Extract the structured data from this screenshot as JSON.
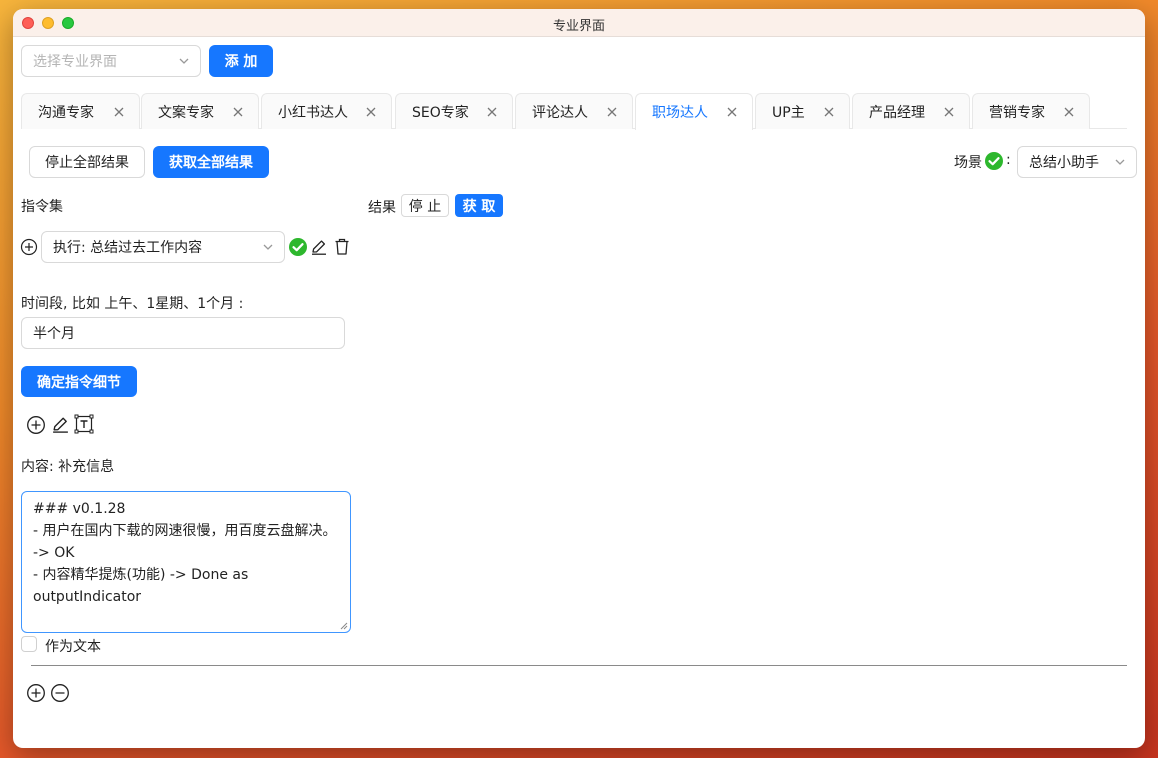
{
  "window": {
    "title": "专业界面"
  },
  "toolbar": {
    "select_placeholder": "选择专业界面",
    "add_label": "添 加"
  },
  "tabs": [
    {
      "label": "沟通专家",
      "active": false
    },
    {
      "label": "文案专家",
      "active": false
    },
    {
      "label": "小红书达人",
      "active": false
    },
    {
      "label": "SEO专家",
      "active": false
    },
    {
      "label": "评论达人",
      "active": false
    },
    {
      "label": "职场达人",
      "active": true
    },
    {
      "label": "UP主",
      "active": false
    },
    {
      "label": "产品经理",
      "active": false
    },
    {
      "label": "营销专家",
      "active": false
    }
  ],
  "actions": {
    "stop_all_label": "停止全部结果",
    "fetch_all_label": "获取全部结果",
    "scene_label": "场景",
    "scene_colon": ":",
    "scene_value": "总结小助手"
  },
  "instructions": {
    "section_label": "指令集",
    "command_value": "执行: 总结过去工作内容",
    "param_label": "时间段, 比如 上午、1星期、1个月 :",
    "param_value": "半个月",
    "confirm_label": "确定指令细节",
    "content_label": "内容: 补充信息",
    "content_lines": [
      "### v0.1.28",
      "",
      "- 用户在国内下载的网速很慢，用百度云盘解决。",
      "-> OK",
      "- 内容精华提炼(功能) -> Done as",
      "outputIndicator"
    ],
    "as_text_label": "作为文本"
  },
  "result": {
    "label": "结果",
    "stop_label": "停 止",
    "fetch_label": "获 取"
  },
  "colors": {
    "primary": "#1677ff",
    "success": "#2db72d",
    "border": "#d9d9d9"
  },
  "icons": {
    "add": "plus-circle-icon",
    "check": "check-circle-icon",
    "edit": "pencil-icon",
    "delete": "trash-icon",
    "text": "text-box-icon",
    "remove": "minus-circle-icon",
    "close": "close-icon",
    "dropdown": "chevron-down-icon"
  }
}
